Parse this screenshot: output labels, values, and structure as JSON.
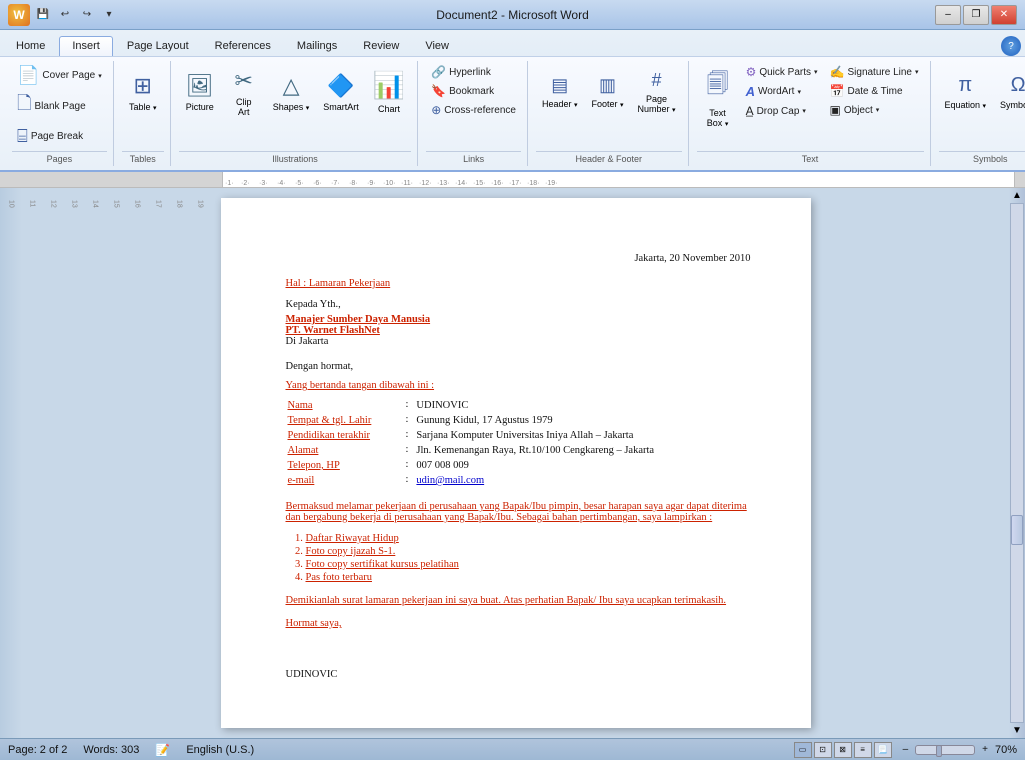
{
  "titleBar": {
    "title": "Document2 - Microsoft Word",
    "controls": [
      "minimize",
      "restore",
      "close"
    ]
  },
  "quickAccess": {
    "buttons": [
      "save",
      "undo",
      "redo",
      "customize"
    ]
  },
  "ribbon": {
    "tabs": [
      "Home",
      "Insert",
      "Page Layout",
      "References",
      "Mailings",
      "Review",
      "View"
    ],
    "activeTab": "Insert",
    "groups": {
      "pages": {
        "label": "Pages",
        "items": [
          "Cover Page",
          "Blank Page",
          "Page Break"
        ]
      },
      "tables": {
        "label": "Tables",
        "items": [
          "Table"
        ]
      },
      "illustrations": {
        "label": "Illustrations",
        "items": [
          "Picture",
          "Clip Art",
          "Shapes",
          "SmartArt",
          "Chart"
        ]
      },
      "links": {
        "label": "Links",
        "items": [
          "Hyperlink",
          "Bookmark",
          "Cross-reference"
        ]
      },
      "headerFooter": {
        "label": "Header & Footer",
        "items": [
          "Header",
          "Footer",
          "Page Number"
        ]
      },
      "text": {
        "label": "Text",
        "items": [
          "Text Box",
          "Quick Parts",
          "WordArt",
          "Drop Cap",
          "Signature Line",
          "Date & Time",
          "Object"
        ]
      },
      "symbols": {
        "label": "Symbols",
        "items": [
          "Equation",
          "Symbol"
        ]
      }
    }
  },
  "document": {
    "date": "Jakarta, 20 November 2010",
    "subject_label": "Hal : Lamaran Pekerjaan",
    "to_label": "Kepada Yth.,",
    "to_name": "Manajer Sumber Daya Manusia",
    "to_company": "PT. Warnet FlashNet",
    "to_place": "Di Jakarta",
    "greeting": "Dengan hormat,",
    "intro_line": "Yang bertanda tangan dibawah ini :",
    "fields": [
      {
        "label": "Nama",
        "value": "UDINOVIC"
      },
      {
        "label": "Tempat & tgl. Lahir",
        "value": "Gunung Kidul, 17 Agustus 1979"
      },
      {
        "label": "Pendidikan terakhir",
        "value": "Sarjana Komputer Universitas Iniya Allah – Jakarta"
      },
      {
        "label": "Alamat",
        "value": "Jln. Kemenangan Raya, Rt.10/100 Cengkareng – Jakarta"
      },
      {
        "label": "Telepon, HP",
        "value": "007 008 009"
      },
      {
        "label": "e-mail",
        "value": "udin@mail.com"
      }
    ],
    "body_paragraph": "Bermaksud melamar pekerjaan di perusahaan yang Bapak/Ibu pimpin, besar harapan saya agar dapat diterima dan bergabung bekerja di perusahaan yang Bapak/Ibu. Sebagai bahan pertimbangan, saya lampirkan :",
    "attachments": [
      "Daftar Riwayat Hidup",
      "Foto copy ijazah S-1.",
      "Foto copy sertifikat kursus pelatihan",
      "Pas foto terbaru"
    ],
    "closing_paragraph": "Demikianlah surat lamaran pekerjaan ini saya buat. Atas perhatian Bapak/ Ibu saya ucapkan terimakasih.",
    "hormat": "Hormat saya,",
    "signature": "UDINOVIC"
  },
  "statusBar": {
    "page": "Page: 2 of 2",
    "words": "Words: 303",
    "language": "English (U.S.)",
    "zoom": "70%"
  }
}
